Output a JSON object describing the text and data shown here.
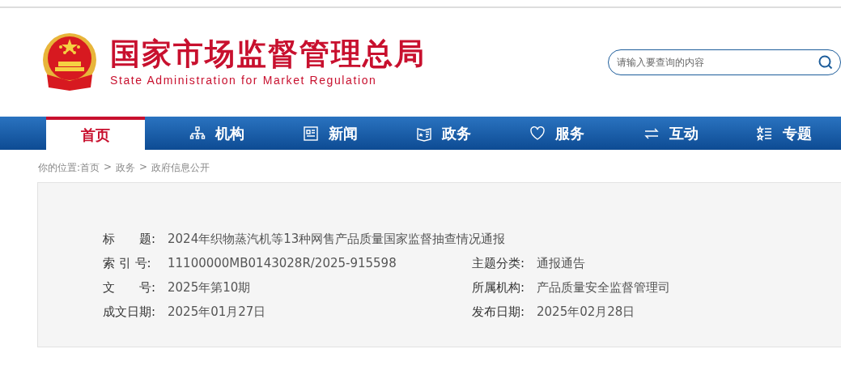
{
  "header": {
    "title": "国家市场监督管理总局",
    "subtitle": "State Administration for Market Regulation"
  },
  "search": {
    "placeholder": "请输入要查询的内容"
  },
  "nav": [
    {
      "label": "首页",
      "selected": true
    },
    {
      "label": "机构",
      "selected": false
    },
    {
      "label": "新闻",
      "selected": false
    },
    {
      "label": "政务",
      "selected": false
    },
    {
      "label": "服务",
      "selected": false
    },
    {
      "label": "互动",
      "selected": false
    },
    {
      "label": "专题",
      "selected": false
    }
  ],
  "breadcrumb": [
    "你的位置:首页",
    ">",
    "政务",
    ">",
    "政府信息公开"
  ],
  "info": [
    [
      {
        "label": "标　　题:",
        "value": "2024年织物蒸汽机等13种网售产品质量国家监督抽查情况通报"
      }
    ],
    [
      {
        "label": "索 引 号:",
        "value": "11100000MB0143028R/2025-915598"
      },
      {
        "label": "主题分类:",
        "value": "通报通告"
      }
    ],
    [
      {
        "label": "文　　号:",
        "value": "2025年第10期"
      },
      {
        "label": "所属机构:",
        "value": "产品质量安全监督管理司"
      }
    ],
    [
      {
        "label": "成文日期:",
        "value": "2025年01月27日"
      },
      {
        "label": "发布日期:",
        "value": "2025年02月28日"
      }
    ]
  ]
}
